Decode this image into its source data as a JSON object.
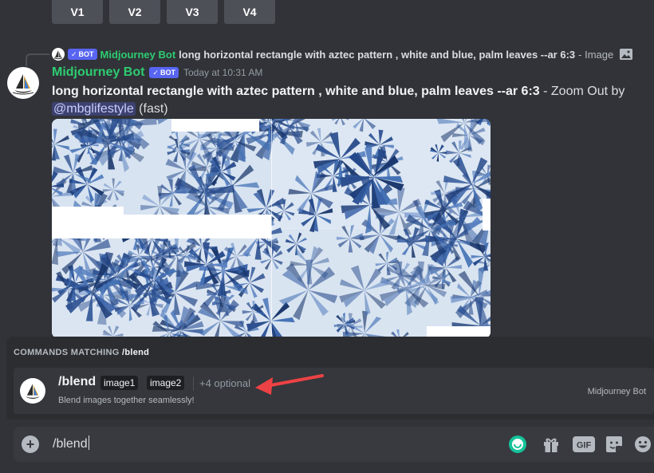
{
  "variation_buttons": [
    "V1",
    "V2",
    "V3",
    "V4"
  ],
  "reply": {
    "author": "Midjourney Bot",
    "bot_tag": "BOT",
    "prompt": "long horizontal rectangle with aztec pattern , white and blue, palm leaves --ar 6:3",
    "suffix": "- Image"
  },
  "message": {
    "author": "Midjourney Bot",
    "bot_tag": "BOT",
    "timestamp": "Today at 10:31 AM",
    "prompt": "long horizontal rectangle with aztec pattern , white and blue, palm leaves --ar 6:3",
    "suffix_1": " - Zoom Out by",
    "mention": "@mbglifestyle",
    "suffix_2": " (fast)"
  },
  "commands": {
    "header_prefix": "COMMANDS MATCHING",
    "header_query": "/blend",
    "item": {
      "name": "/blend",
      "options": [
        "image1",
        "image2"
      ],
      "more": "+4 optional",
      "description": "Blend images together seamlessly!",
      "source": "Midjourney Bot"
    }
  },
  "input": {
    "value": "/blend"
  },
  "colors": {
    "background": "#313338",
    "bot_name": "#2ecc71",
    "bot_tag": "#5865f2",
    "arrow": "#ed4245",
    "image_blue": "#1f3f7a"
  },
  "icons": [
    "plus-circle-icon",
    "emoji-status-icon",
    "gift-icon",
    "gif-icon",
    "sticker-icon",
    "emoji-icon",
    "image-icon"
  ]
}
